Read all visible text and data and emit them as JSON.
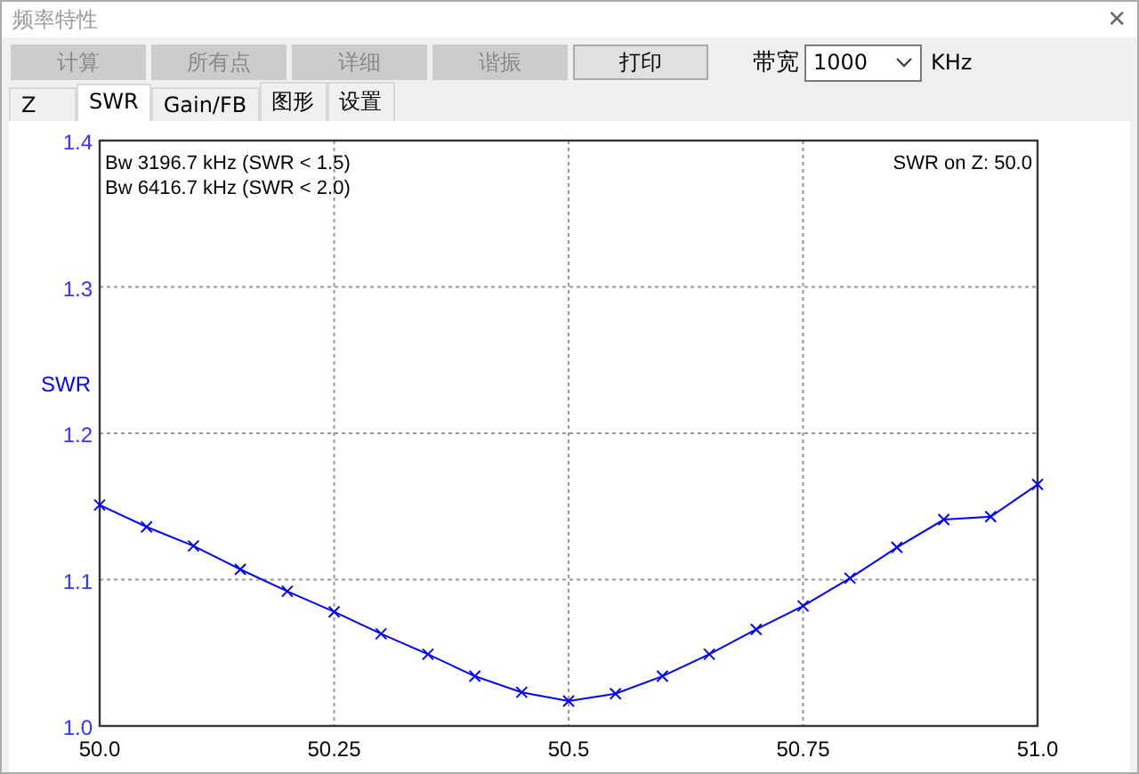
{
  "window": {
    "title": "频率特性",
    "close": "✕"
  },
  "toolbar": {
    "buttons": [
      {
        "label": "计算",
        "disabled": true
      },
      {
        "label": "所有点",
        "disabled": true
      },
      {
        "label": "详细",
        "disabled": true
      },
      {
        "label": "谐振",
        "disabled": true
      },
      {
        "label": "打印",
        "disabled": false
      }
    ],
    "bandwidth": {
      "label": "带宽",
      "value": "1000",
      "unit": "KHz"
    }
  },
  "tabs": [
    {
      "label": "Z",
      "selected": false
    },
    {
      "label": "SWR",
      "selected": true
    },
    {
      "label": "Gain/FB",
      "selected": false
    },
    {
      "label": "图形",
      "selected": false
    },
    {
      "label": "设置",
      "selected": false
    }
  ],
  "notes": [
    "Bw 3196.7 kHz (SWR < 1.5)",
    "Bw 6416.7 kHz (SWR < 2.0)"
  ],
  "reference": "SWR on Z: 50.0",
  "chart_data": {
    "type": "line",
    "grid": true,
    "ylabel": "SWR",
    "xlim": [
      50.0,
      51.0
    ],
    "ylim": [
      1.0,
      1.4
    ],
    "xticks": [
      {
        "value": 50.0,
        "label": "50.0"
      },
      {
        "value": 50.25,
        "label": "50.25"
      },
      {
        "value": 50.5,
        "label": "50.5"
      },
      {
        "value": 50.75,
        "label": "50.75"
      },
      {
        "value": 51.0,
        "label": "51.0"
      }
    ],
    "yticks": [
      {
        "value": 1.0,
        "label": "1.0"
      },
      {
        "value": 1.1,
        "label": "1.1"
      },
      {
        "value": 1.2,
        "label": "1.2"
      },
      {
        "value": 1.3,
        "label": "1.3"
      },
      {
        "value": 1.4,
        "label": "1.4"
      }
    ],
    "x": [
      50.0,
      50.05,
      50.1,
      50.15,
      50.2,
      50.25,
      50.3,
      50.35,
      50.4,
      50.45,
      50.5,
      50.55,
      50.6,
      50.65,
      50.7,
      50.75,
      50.8,
      50.85,
      50.9,
      50.95,
      51.0
    ],
    "series": [
      {
        "color": "#0000ff",
        "marker": "x",
        "values": [
          1.151,
          1.136,
          1.123,
          1.107,
          1.092,
          1.078,
          1.063,
          1.049,
          1.034,
          1.023,
          1.017,
          1.022,
          1.034,
          1.049,
          1.066,
          1.082,
          1.101,
          1.122,
          1.141,
          1.143,
          1.165
        ]
      }
    ]
  }
}
